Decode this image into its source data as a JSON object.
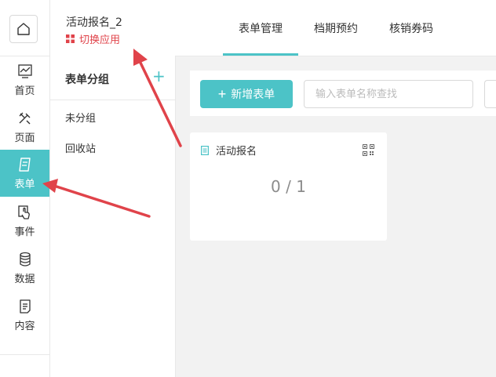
{
  "app": {
    "name": "活动报名_2",
    "switch_label": "切换应用"
  },
  "tabs": [
    {
      "label": "表单管理",
      "active": true
    },
    {
      "label": "档期预约",
      "active": false
    },
    {
      "label": "核销券码",
      "active": false
    }
  ],
  "nav": [
    {
      "label": "首页",
      "icon": "chart-icon"
    },
    {
      "label": "页面",
      "icon": "tools-icon"
    },
    {
      "label": "表单",
      "icon": "form-icon",
      "active": true
    },
    {
      "label": "事件",
      "icon": "touch-icon"
    },
    {
      "label": "数据",
      "icon": "database-icon"
    },
    {
      "label": "内容",
      "icon": "content-icon"
    }
  ],
  "groups": {
    "title": "表单分组",
    "add": "+",
    "items": [
      "未分组",
      "回收站"
    ]
  },
  "toolbar": {
    "new_form_label": "新增表单",
    "new_form_plus": "+",
    "search_placeholder": "输入表单名称查找"
  },
  "card": {
    "title": "活动报名",
    "count": "0 / 1"
  },
  "colors": {
    "accent": "#4cc3c7",
    "switch": "#e0434a",
    "arrow": "#e0434a"
  }
}
